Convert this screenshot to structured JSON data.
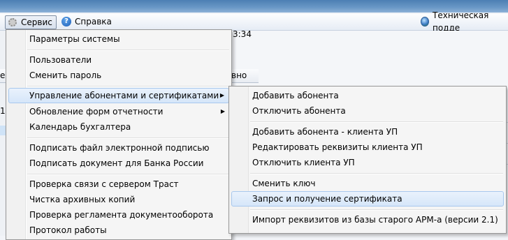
{
  "menubar": {
    "service": "Сервис",
    "help": "Справка",
    "tech_support": "Техническая подде"
  },
  "background": {
    "time_fragment": "3:34",
    "header_fragment": "вно",
    "left_fragments": [
      "е",
      "1)"
    ]
  },
  "service_menu": {
    "items": [
      {
        "label": "Параметры системы"
      },
      {
        "label": "Пользователи"
      },
      {
        "label": "Сменить пароль"
      },
      {
        "label": "Управление абонентами и сертификатами",
        "submenu": true
      },
      {
        "label": "Обновление форм отчетности",
        "submenu": true
      },
      {
        "label": "Календарь бухгалтера"
      },
      {
        "label": "Подписать файл электронной подписью"
      },
      {
        "label": "Подписать документ для Банка России"
      },
      {
        "label": "Проверка связи с сервером Траст"
      },
      {
        "label": "Чистка архивных копий"
      },
      {
        "label": "Проверка регламента документооборота"
      },
      {
        "label": "Протокол работы"
      }
    ]
  },
  "subscriber_submenu": {
    "items": [
      {
        "label": "Добавить абонента"
      },
      {
        "label": "Отключить абонента"
      },
      {
        "label": "Добавить абонента - клиента УП"
      },
      {
        "label": "Редактировать реквизиты клиента УП"
      },
      {
        "label": "Отключить клиента УП"
      },
      {
        "label": "Сменить ключ"
      },
      {
        "label": "Запрос и получение сертификата"
      },
      {
        "label": "Импорт реквизитов из базы старого АРМ-а (версии 2.1)"
      }
    ]
  }
}
